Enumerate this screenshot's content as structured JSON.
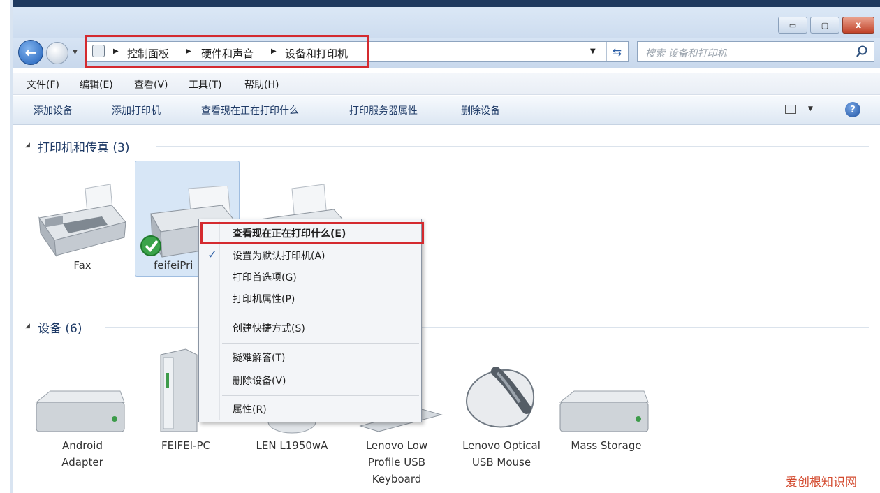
{
  "window": {
    "controls": {
      "minimize": "▭",
      "maximize": "▢",
      "close": "x"
    }
  },
  "navigation": {
    "back_glyph": "←",
    "breadcrumb": [
      "控制面板",
      "硬件和声音",
      "设备和打印机"
    ],
    "search_placeholder": "搜索 设备和打印机"
  },
  "menubar": {
    "items": [
      "文件(F)",
      "编辑(E)",
      "查看(V)",
      "工具(T)",
      "帮助(H)"
    ]
  },
  "commandbar": {
    "items": [
      "添加设备",
      "添加打印机",
      "查看现在正在打印什么",
      "打印服务器属性",
      "删除设备"
    ],
    "help_glyph": "?"
  },
  "groups": {
    "printers": {
      "title": "打印机和传真 (3)",
      "items": [
        "Fax",
        "feifeiPri",
        ""
      ]
    },
    "devices": {
      "title": "设备 (6)",
      "items": [
        {
          "line1": "Android",
          "line2": "Adapter",
          "line3": ""
        },
        {
          "line1": "FEIFEI-PC",
          "line2": "",
          "line3": ""
        },
        {
          "line1": "LEN L1950wA",
          "line2": "",
          "line3": ""
        },
        {
          "line1": "Lenovo Low",
          "line2": "Profile USB",
          "line3": "Keyboard"
        },
        {
          "line1": "Lenovo Optical",
          "line2": "USB Mouse",
          "line3": ""
        },
        {
          "line1": "Mass Storage",
          "line2": "",
          "line3": ""
        }
      ]
    }
  },
  "context_menu": {
    "items": [
      "查看现在正在打印什么(E)",
      "设置为默认打印机(A)",
      "打印首选项(G)",
      "打印机属性(P)",
      "创建快捷方式(S)",
      "疑难解答(T)",
      "删除设备(V)",
      "属性(R)"
    ],
    "checked_item": "设置为默认打印机(A)"
  },
  "watermark": "爱创根知识网",
  "colors": {
    "highlight_red": "#d42a2f",
    "link_blue": "#1e3a66",
    "selection": "#d7e6f6"
  }
}
